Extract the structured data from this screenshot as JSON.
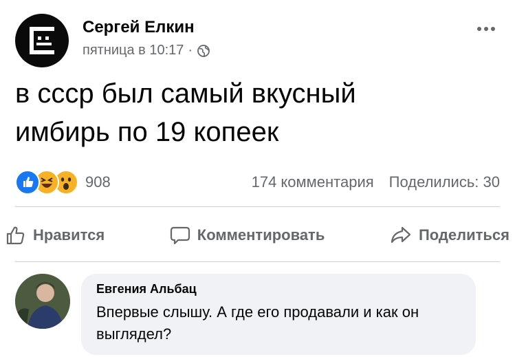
{
  "post": {
    "author": "Сергей Елкин",
    "timestamp": "пятница в 10:17",
    "separator": "·",
    "privacy_icon": "globe-icon",
    "text_line1": "в ссср был самый вкусный",
    "text_line2": "имбирь по 19 копеек",
    "more_icon": "more-horizontal-icon"
  },
  "stats": {
    "reaction_icons": [
      "like-icon",
      "haha-icon",
      "wow-icon"
    ],
    "reaction_count": "908",
    "comments": "174 комментария",
    "shares": "Поделились: 30"
  },
  "actions": {
    "like_label": "Нравится",
    "comment_label": "Комментировать",
    "share_label": "Поделиться"
  },
  "comment": {
    "author": "Евгения Альбац",
    "text": "Впервые слышу. А где его продавали и как он выглядел?"
  },
  "colors": {
    "text": "#050505",
    "secondary": "#65676b",
    "bubble": "#f0f2f5",
    "like_blue": "#1877f2",
    "emoji_yellow": "#f7b125"
  }
}
